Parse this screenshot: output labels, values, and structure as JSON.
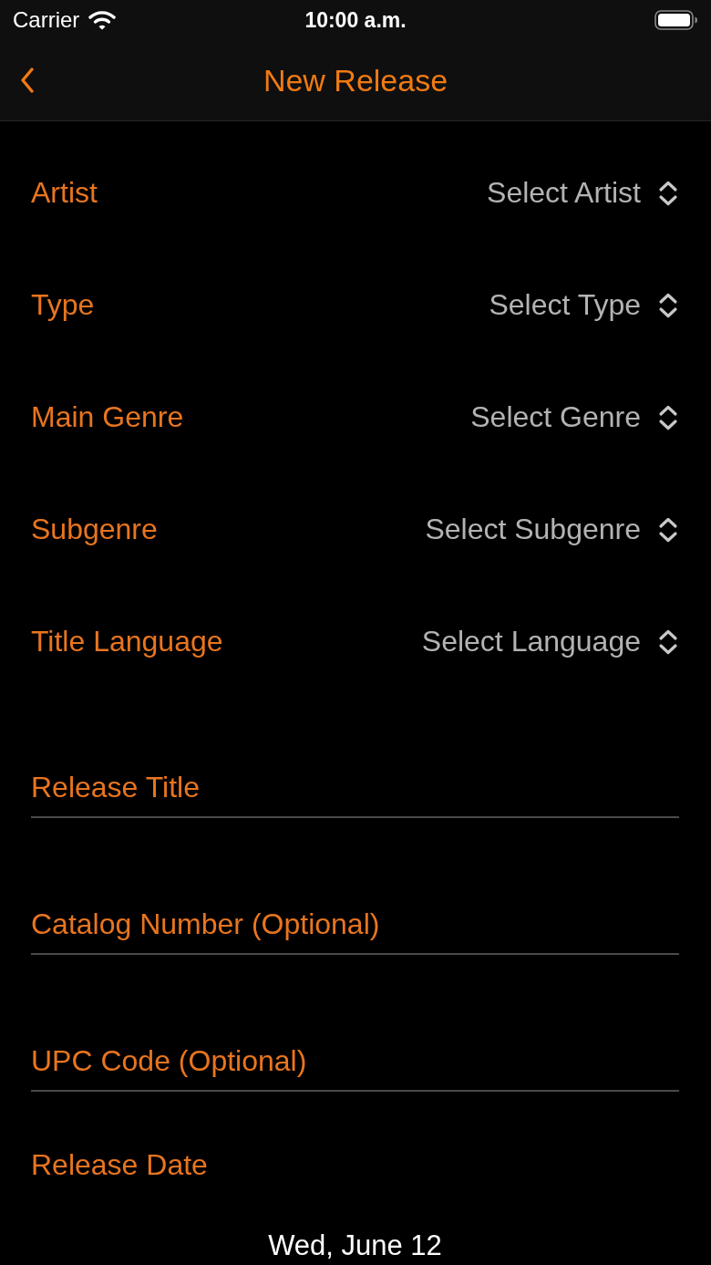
{
  "status_bar": {
    "carrier": "Carrier",
    "time": "10:00 a.m."
  },
  "nav_bar": {
    "title": "New Release"
  },
  "pickers": [
    {
      "label": "Artist",
      "placeholder": "Select Artist"
    },
    {
      "label": "Type",
      "placeholder": "Select Type"
    },
    {
      "label": "Main Genre",
      "placeholder": "Select Genre"
    },
    {
      "label": "Subgenre",
      "placeholder": "Select Subgenre"
    },
    {
      "label": "Title Language",
      "placeholder": "Select Language"
    }
  ],
  "text_fields": [
    {
      "placeholder": "Release Title"
    },
    {
      "placeholder": "Catalog Number (Optional)"
    },
    {
      "placeholder": "UPC Code (Optional)"
    }
  ],
  "release_date": {
    "label": "Release Date",
    "value": "Wed, June 12"
  }
}
